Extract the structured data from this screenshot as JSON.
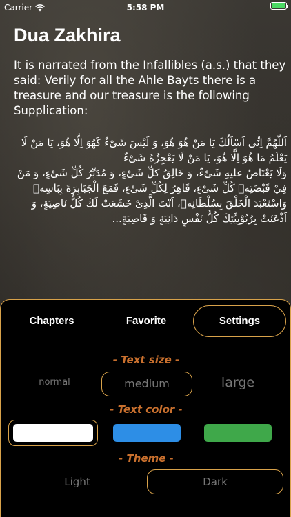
{
  "status_bar": {
    "carrier": "Carrier",
    "time": "5:58 PM",
    "battery_level": 1.0,
    "battery_color": "#4cd964"
  },
  "page": {
    "title": "Dua Zakhira",
    "intro": "It is narrated from the Infallibles (a.s.) that they said: Verily for all the Ahle Bayts there is a treasure and our treasure is the following Supplication:",
    "arabic_lines": [
      "اَللّٰهُمَّ اِنِّى اَسْاَلُكَ يَا مَنْ هُوَ هُوَ، وَ لَيْسَ شَىْءٌ كَهُوَ اِلَّا هُوَ، يَا مَنْ لَا يَعْلَمُ مَا هُوَ اِلَّا هُوَ، يَا مَنْ لَا يَعْجِزُهُ شَىْءٌ",
      "وَلَا يَعْتَاصُ عليهِ شَىْءٌ، وَ خَالِقُ كلِّ شَىْءٍ، وَ مُدَبِّرُ كُلِّ شَىْءٍ، وَ مَنْ فِيْ قَبْضَتِهٖ كُلِّ شَىْءٍ، قَاهِرُ لِكُلِّ شَىْءٍ، قَمَعَ الْجَبَابِرَةَ بِبَاسِهٖ",
      "وَاسْتَعْبَدَ الْخَلْقَ بِسُلْطَانِهٖ، اَنْتَ الَّذِىْ خَشَعَتْ لَكَ كُلُّ نَاصِيَةٍ، وَ اَذْعَنَتْ بِرُبُوْبِيَّتِكَ كُلُّ نَفْسٍ دَانِيَةٍ وَ قَاصِيَةٍ..."
    ]
  },
  "panel": {
    "accent_color": "#d8a24a",
    "label_color": "#c9702e",
    "tabs": [
      {
        "label": "Chapters",
        "selected": false
      },
      {
        "label": "Favorite",
        "selected": false
      },
      {
        "label": "Settings",
        "selected": true
      }
    ],
    "text_size": {
      "label": "- Text size -",
      "options": [
        "normal",
        "medium",
        "large"
      ],
      "selected": "medium"
    },
    "text_color": {
      "label": "- Text color -",
      "options": [
        {
          "name": "white",
          "color": "#ffffff"
        },
        {
          "name": "blue",
          "color": "#2d8ee6"
        },
        {
          "name": "green",
          "color": "#3fa84a"
        }
      ],
      "selected": "white"
    },
    "theme": {
      "label": "- Theme -",
      "options": [
        "Light",
        "Dark"
      ],
      "selected": "Dark"
    }
  }
}
